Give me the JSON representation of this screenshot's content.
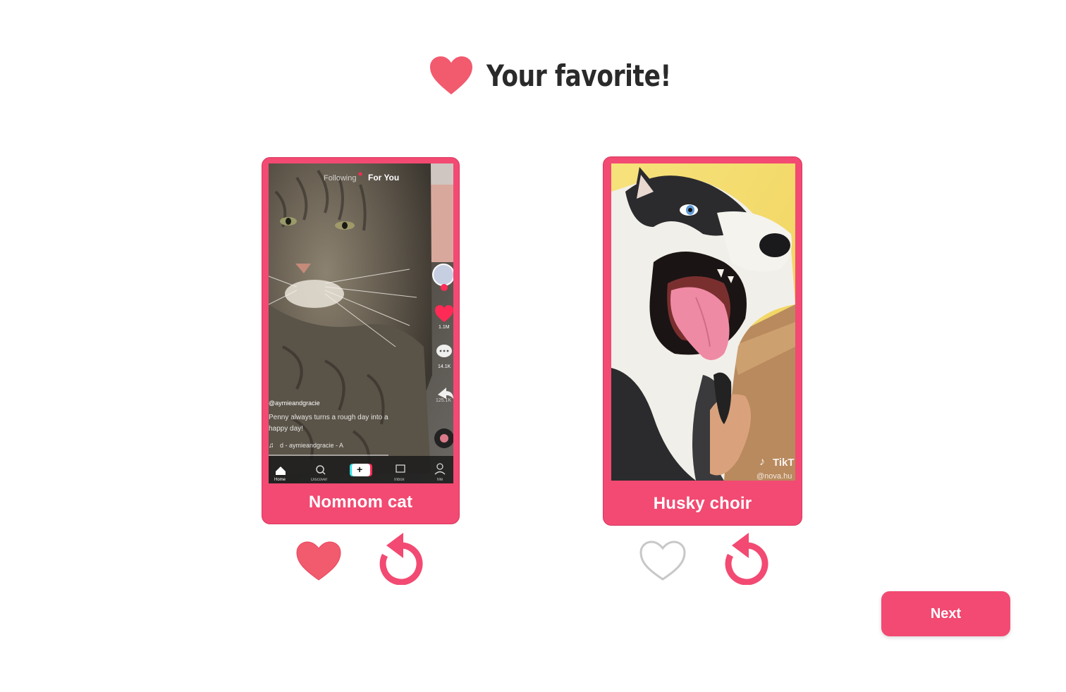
{
  "header": {
    "title": "Your favorite!",
    "icon": "heart-icon"
  },
  "colors": {
    "accent": "#f24a72",
    "heart_filled": "#f25a6e",
    "heart_outline": "#c8c8c8",
    "title_text": "#2a2a2a"
  },
  "cards": [
    {
      "label": "Nomnom cat",
      "favorited": true,
      "thumbnail": {
        "tabs": [
          "Following",
          "For You"
        ],
        "username": "@aymieandgracie",
        "caption_line1": "Penny always turns a rough day into a",
        "caption_line2": "happy day!",
        "sound": "d - aymieandgracie - A",
        "likes": "1.1M",
        "comments": "14.1K",
        "shares": "125.1K",
        "nav": [
          "Home",
          "Discover",
          "Inbox",
          "Me"
        ]
      }
    },
    {
      "label": "Husky choir",
      "favorited": false,
      "thumbnail": {
        "watermark_brand": "TikT",
        "watermark_handle": "@nova.hu"
      }
    }
  ],
  "next_button": {
    "label": "Next"
  }
}
